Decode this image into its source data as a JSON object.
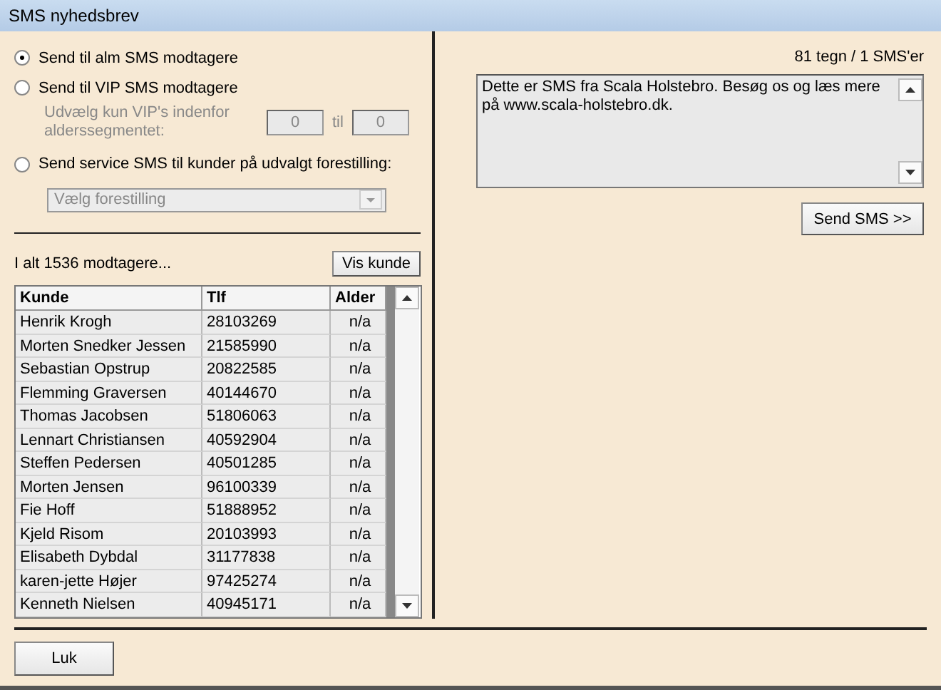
{
  "window": {
    "title": "SMS nyhedsbrev"
  },
  "options": [
    {
      "label": "Send til alm SMS modtagere",
      "selected": true
    },
    {
      "label": "Send til VIP SMS modtagere",
      "selected": false
    }
  ],
  "age_filter": {
    "label": "Udvælg kun VIP's indenfor alderssegmentet:",
    "from": "0",
    "separator": "til",
    "to": "0",
    "disabled": true
  },
  "service_option": {
    "label": "Send service SMS til kunder på udvalgt forestilling:",
    "selected": false
  },
  "show_select": {
    "value": "Vælg forestilling",
    "disabled": true
  },
  "recipient_count": "I alt 1536 modtagere...",
  "show_customer_button": "Vis kunde",
  "table": {
    "columns": [
      "Kunde",
      "Tlf",
      "Alder"
    ],
    "rows": [
      [
        "Henrik Krogh",
        "28103269",
        "n/a"
      ],
      [
        "Morten Snedker Jessen",
        "21585990",
        "n/a"
      ],
      [
        "Sebastian Opstrup",
        "20822585",
        "n/a"
      ],
      [
        "Flemming Graversen",
        "40144670",
        "n/a"
      ],
      [
        "Thomas Jacobsen",
        "51806063",
        "n/a"
      ],
      [
        "Lennart Christiansen",
        "40592904",
        "n/a"
      ],
      [
        "Steffen Pedersen",
        "40501285",
        "n/a"
      ],
      [
        "Morten Jensen",
        "96100339",
        "n/a"
      ],
      [
        "Fie Hoff",
        "51888952",
        "n/a"
      ],
      [
        "Kjeld Risom",
        "20103993",
        "n/a"
      ],
      [
        "Elisabeth Dybdal",
        "31177838",
        "n/a"
      ],
      [
        "karen-jette Højer",
        "97425274",
        "n/a"
      ],
      [
        "Kenneth Nielsen",
        "40945171",
        "n/a"
      ]
    ]
  },
  "counter": "81 tegn / 1 SMS'er",
  "message": "Dette er SMS fra Scala Holstebro. Besøg os og læs mere på www.scala-holstebro.dk.",
  "send_button": "Send SMS >>",
  "close_button": "Luk"
}
